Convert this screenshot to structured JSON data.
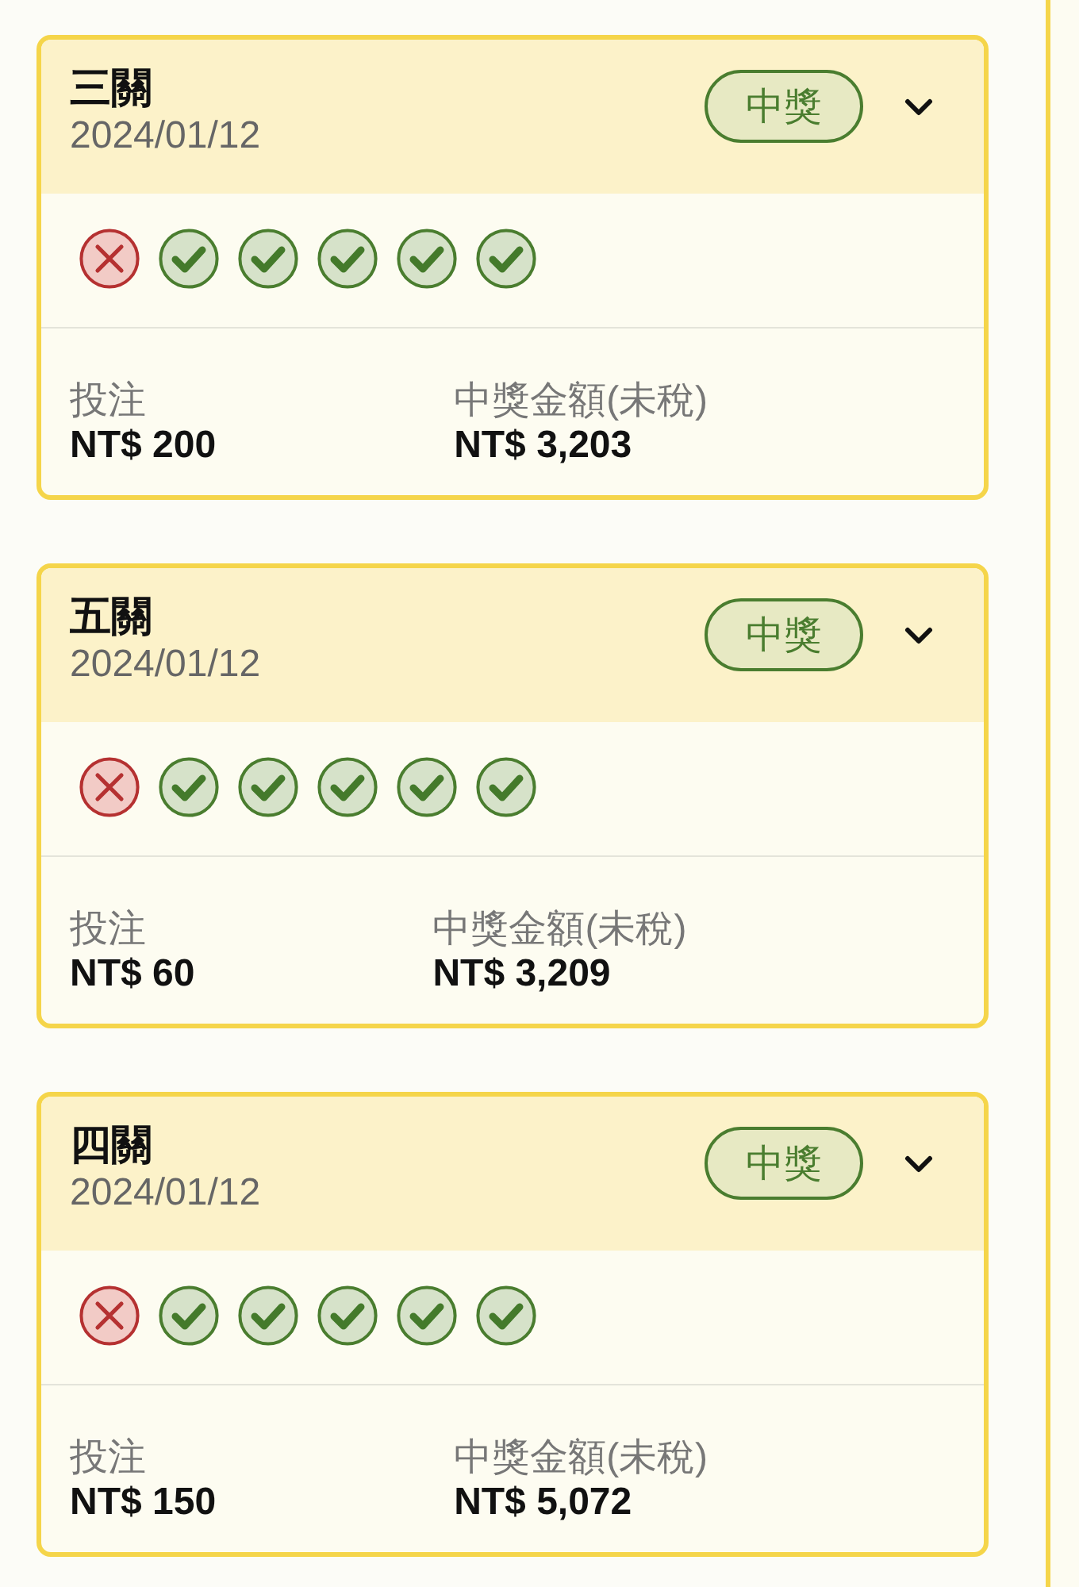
{
  "cards": [
    {
      "title": "三關",
      "date": "2024/01/12",
      "badge": "中獎",
      "legs": [
        {
          "hit": false
        },
        {
          "hit": true
        },
        {
          "hit": true
        },
        {
          "hit": true
        },
        {
          "hit": true
        },
        {
          "hit": true
        }
      ],
      "stake_label": "投注",
      "stake": "NT$ 200",
      "payout_label": "中獎金額(未稅)",
      "payout": "NT$ 3,203"
    },
    {
      "title": "五關",
      "date": "2024/01/12",
      "badge": "中獎",
      "legs": [
        {
          "hit": false
        },
        {
          "hit": true
        },
        {
          "hit": true
        },
        {
          "hit": true
        },
        {
          "hit": true
        },
        {
          "hit": true
        }
      ],
      "stake_label": "投注",
      "stake": "NT$ 60",
      "payout_label": "中獎金額(未稅)",
      "payout": "NT$ 3,209"
    },
    {
      "title": "四關",
      "date": "2024/01/12",
      "badge": "中獎",
      "legs": [
        {
          "hit": false
        },
        {
          "hit": true
        },
        {
          "hit": true
        },
        {
          "hit": true
        },
        {
          "hit": true
        },
        {
          "hit": true
        }
      ],
      "stake_label": "投注",
      "stake": "NT$ 150",
      "payout_label": "中獎金額(未稅)",
      "payout": "NT$ 5,072"
    }
  ]
}
